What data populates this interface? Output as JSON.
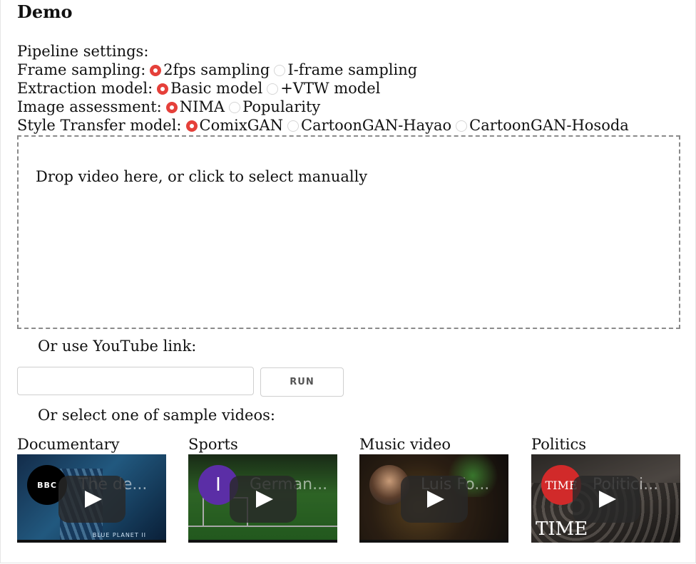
{
  "page": {
    "title": "Demo"
  },
  "settings": {
    "heading": "Pipeline settings:",
    "frame_sampling": {
      "label": "Frame sampling:",
      "options": [
        "2fps sampling",
        "I-frame sampling"
      ],
      "selected": "2fps sampling"
    },
    "extraction_model": {
      "label": "Extraction model:",
      "options": [
        "Basic model",
        "+VTW model"
      ],
      "selected": "Basic model"
    },
    "image_assessment": {
      "label": "Image assessment:",
      "options": [
        "NIMA",
        "Popularity"
      ],
      "selected": "NIMA"
    },
    "style_transfer": {
      "label": "Style Transfer model:",
      "options": [
        "ComixGAN",
        "CartoonGAN-Hayao",
        "CartoonGAN-Hosoda"
      ],
      "selected": "ComixGAN"
    }
  },
  "dropzone": {
    "text": "Drop video here, or click to select manually"
  },
  "youtube": {
    "label": "Or use YouTube link:",
    "input_value": "",
    "run_label": "RUN"
  },
  "samples": {
    "label": "Or select one of sample videos:",
    "videos": [
      {
        "category": "Documentary",
        "title": "The de...",
        "channel": "BBC",
        "extra": "BLUE PLANET II"
      },
      {
        "category": "Sports",
        "title": "German...",
        "channel": "I",
        "extra": ""
      },
      {
        "category": "Music video",
        "title": "Luis Fo...",
        "channel": "",
        "extra": ""
      },
      {
        "category": "Politics",
        "title": "Politici...",
        "channel": "TIME",
        "extra": "TIME"
      }
    ]
  },
  "colors": {
    "radio_selected": "#e5403a",
    "dropzone_border": "#8a8a8a"
  }
}
